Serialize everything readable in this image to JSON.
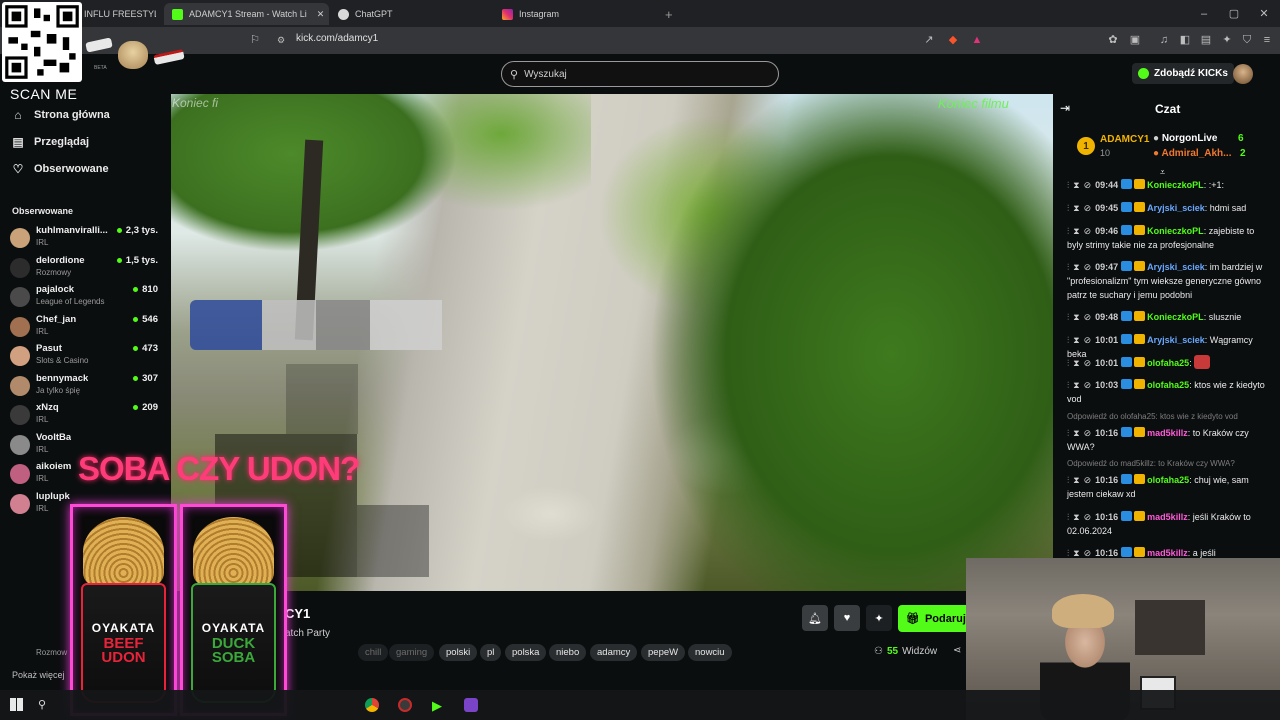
{
  "browser": {
    "tabs": [
      {
        "title": "INFLU FREESTYLE (g",
        "color": "#3a3a3a",
        "active": false
      },
      {
        "title": "ADAMCY1 Stream - Watch Li",
        "color": "#53fc18",
        "active": true
      },
      {
        "title": "ChatGPT",
        "color": "#cccccc",
        "active": false
      },
      {
        "title": "Instagram",
        "color": "#e1306c",
        "active": false
      }
    ],
    "url": "kick.com/adamcy1",
    "new_tab": "+"
  },
  "header": {
    "search_placeholder": "Wyszukaj",
    "kicks_button": "Zdobądź KICKs"
  },
  "overlay": {
    "scan_me": "SCAN ME",
    "beta": "BETA"
  },
  "sidebar": {
    "nav": [
      {
        "label": "Strona główna",
        "icon": "home-icon"
      },
      {
        "label": "Przeglądaj",
        "icon": "browse-icon"
      },
      {
        "label": "Obserwowane",
        "icon": "heart-icon"
      }
    ],
    "followed_title": "Obserwowane",
    "followed": [
      {
        "name": "kuhlmanviralli...",
        "category": "IRL",
        "viewers": "2,3 tys.",
        "color": "#c9a27a"
      },
      {
        "name": "delordione",
        "category": "Rozmowy",
        "viewers": "1,5 tys.",
        "color": "#2c2c2c"
      },
      {
        "name": "pajalock",
        "category": "League of Legends",
        "viewers": "810",
        "color": "#4a4a4a"
      },
      {
        "name": "Chef_jan",
        "category": "IRL",
        "viewers": "546",
        "color": "#a07050"
      },
      {
        "name": "Pasut",
        "category": "Slots & Casino",
        "viewers": "473",
        "color": "#d0a080"
      },
      {
        "name": "bennymack",
        "category": "Ja tylko śpię",
        "viewers": "307",
        "color": "#b08a6a"
      },
      {
        "name": "xNzq",
        "category": "IRL",
        "viewers": "209",
        "color": "#3a3a3a"
      },
      {
        "name": "VooltBa",
        "category": "IRL",
        "viewers": "",
        "color": "#8a8a8a"
      },
      {
        "name": "aikoiem",
        "category": "IRL",
        "viewers": "",
        "color": "#c06080"
      },
      {
        "name": "luplupk",
        "category": "IRL",
        "viewers": "",
        "color": "#d08090"
      }
    ],
    "rozmowy": "Rozmow",
    "show_more": "Pokaż więcej"
  },
  "video": {
    "watermark_right": "Koniec filmu",
    "watermark_left": "Koniec fi"
  },
  "promo": {
    "title": "SOBA CZY UDON?",
    "cups": [
      {
        "brand": "OYAKATA",
        "kind": "BEEF UDON",
        "color": "#e8233a"
      },
      {
        "brand": "OYAKATA",
        "kind": "DUCK SOBA",
        "color": "#3aa83a"
      }
    ]
  },
  "stream": {
    "title": "CY1",
    "category": "atch Party",
    "tags": [
      {
        "label": "chill",
        "dim": true
      },
      {
        "label": "gaming",
        "dim": true
      },
      {
        "label": "polski",
        "dim": false
      },
      {
        "label": "pl",
        "dim": false
      },
      {
        "label": "polska",
        "dim": false
      },
      {
        "label": "niebo",
        "dim": false
      },
      {
        "label": "adamcy",
        "dim": false
      },
      {
        "label": "pepeW",
        "dim": false
      },
      {
        "label": "nowciu",
        "dim": false
      }
    ],
    "viewers_count": "55",
    "viewers_label": "Widzów",
    "gift_button": "Podaruj s"
  },
  "chat": {
    "title": "Czat",
    "leaders": [
      {
        "rank": "1",
        "name": "ADAMCY1",
        "score": "10",
        "color": "#f0b400"
      },
      {
        "name": "NorgonLive",
        "score": "6",
        "color": "#ffffff"
      },
      {
        "name": "Admiral_Akh...",
        "score": "2",
        "color": "#f07830"
      }
    ],
    "messages": [
      {
        "time": "09:44",
        "user": "KonieczkoPL",
        "color": "#53fc18",
        "text": ":+1:"
      },
      {
        "time": "09:45",
        "user": "Aryjski_sciek",
        "color": "#6aa8ff",
        "text": "hdmi sad"
      },
      {
        "time": "09:46",
        "user": "KonieczkoPL",
        "color": "#53fc18",
        "text": "zajebiste to byly strimy takie nie za profesjonalne"
      },
      {
        "time": "09:47",
        "user": "Aryjski_sciek",
        "color": "#6aa8ff",
        "text": "im bardziej w \"profesionalizm\" tym wieksze generyczne gówno patrz te suchary i jemu podobni"
      },
      {
        "time": "09:48",
        "user": "KonieczkoPL",
        "color": "#53fc18",
        "text": "slusznie"
      },
      {
        "time": "10:01",
        "user": "Aryjski_sciek",
        "color": "#6aa8ff",
        "text": "Wągramcy beka"
      },
      {
        "time": "10:01",
        "user": "olofaha25",
        "color": "#53fc18",
        "text": ""
      },
      {
        "time": "10:03",
        "user": "olofaha25",
        "color": "#53fc18",
        "text": "ktos wie z kiedyto vod"
      },
      {
        "time": "10:16",
        "user": "mad5killz",
        "color": "#ff5ad8",
        "text": "to Kraków czy WWA?",
        "reply": "Odpowiedź do olofaha25: ktos wie z kiedyto vod"
      },
      {
        "time": "10:16",
        "user": "olofaha25",
        "color": "#53fc18",
        "text": "chuj wie, sam jestem ciekaw xd",
        "reply": "Odpowiedź do mad5killz: to Kraków czy WWA?"
      },
      {
        "time": "10:16",
        "user": "mad5killz",
        "color": "#ff5ad8",
        "text": "jeśli Kraków to 02.06.2024"
      },
      {
        "time": "10:16",
        "user": "mad5killz",
        "color": "#ff5ad8",
        "text": "a jeśli"
      }
    ]
  }
}
